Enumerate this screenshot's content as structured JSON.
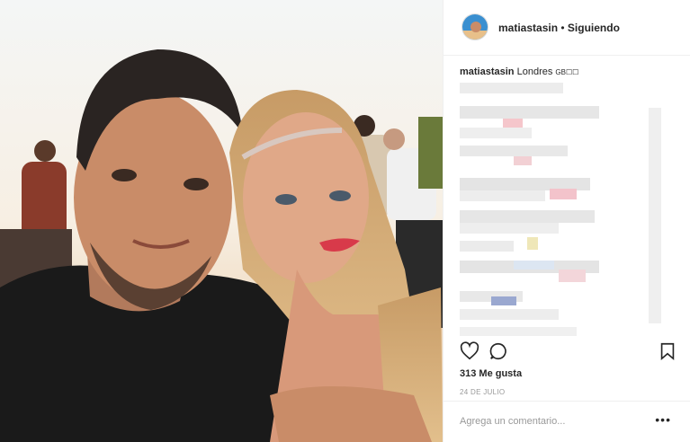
{
  "post": {
    "username": "matiastasin",
    "separator": " • ",
    "follow_status": "Siguiendo",
    "caption_user": "matiastasin",
    "caption_text": "Londres",
    "caption_emoji": "GB☐☐",
    "likes": "313 Me gusta",
    "date": "24 DE JULIO",
    "comment_placeholder": "Agrega un comentario...",
    "more_label": "•••"
  },
  "icons": [
    "heart-icon",
    "comment-icon",
    "bookmark-icon"
  ]
}
